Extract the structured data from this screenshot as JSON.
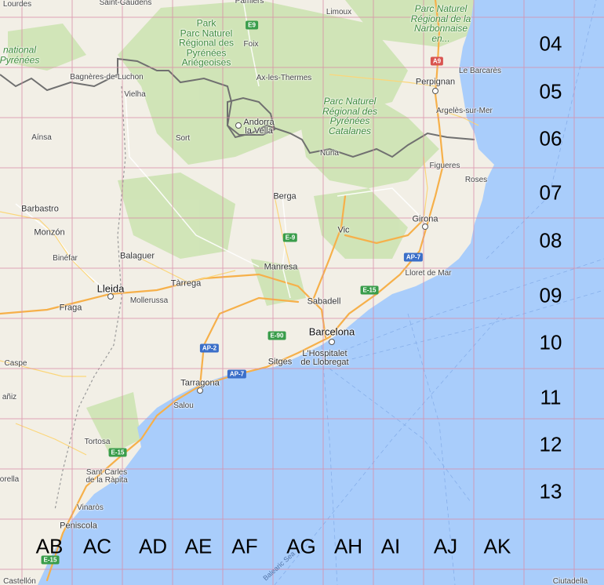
{
  "map": {
    "country_cities": [
      {
        "name": "Lourdes"
      },
      {
        "name": "Saint-Gaudens"
      },
      {
        "name": "Pamiers"
      },
      {
        "name": "Limoux"
      },
      {
        "name": "Bagnères-de-Luchon"
      },
      {
        "name": "Foix"
      },
      {
        "name": "Vielha"
      },
      {
        "name": "Ax-les-Thermes"
      },
      {
        "name": "Perpignan"
      },
      {
        "name": "Le Barcarès"
      },
      {
        "name": "Argelès-sur-Mer"
      },
      {
        "name": "Andorra\nla Vella"
      },
      {
        "name": "Aínsa"
      },
      {
        "name": "Sort"
      },
      {
        "name": "Núria"
      },
      {
        "name": "Figueres"
      },
      {
        "name": "Roses"
      },
      {
        "name": "Barbastro"
      },
      {
        "name": "Berga"
      },
      {
        "name": "Monzón"
      },
      {
        "name": "Vic"
      },
      {
        "name": "Girona"
      },
      {
        "name": "Binéfar"
      },
      {
        "name": "Balaguer"
      },
      {
        "name": "Manresa"
      },
      {
        "name": "Lloret de Mar"
      },
      {
        "name": "Lleida"
      },
      {
        "name": "Tàrrega"
      },
      {
        "name": "Mollerussa"
      },
      {
        "name": "Sabadell"
      },
      {
        "name": "Fraga"
      },
      {
        "name": "Barcelona"
      },
      {
        "name": "L'Hospitalet\nde Llobregat"
      },
      {
        "name": "Sitges"
      },
      {
        "name": "Caspe"
      },
      {
        "name": "Tarragona"
      },
      {
        "name": "Salou"
      },
      {
        "name": "Tortosa"
      },
      {
        "name": "Sant Carles\nde la Ràpita"
      },
      {
        "name": "Vinaròs"
      },
      {
        "name": "Peniscola"
      },
      {
        "name": "Castellón"
      },
      {
        "name": "Ciutadella"
      },
      {
        "name": "añiz"
      },
      {
        "name": "orella"
      }
    ],
    "parks": [
      {
        "name": "Park\nParc Naturel\nRégional des\nPyrénées\nAriégeoises"
      },
      {
        "name": "Parc Naturel\nRégional de la\nNarbonnaise\nen..."
      },
      {
        "name": "Parc Naturel\nRégional des\nPyrénées\nCatalanes"
      },
      {
        "name": "national\nPyrénées"
      }
    ],
    "road_shields": [
      "E9",
      "A9",
      "E-9",
      "AP-7",
      "E-15",
      "E-90",
      "AP-2",
      "AP-7",
      "E-15",
      "E-15"
    ],
    "sea_label": "Balearic Sea",
    "grid_rows": [
      "04",
      "05",
      "06",
      "07",
      "08",
      "09",
      "10",
      "11",
      "12",
      "13"
    ],
    "grid_cols": [
      "AB",
      "AC",
      "AD",
      "AE",
      "AF",
      "AG",
      "AH",
      "AI",
      "AJ",
      "AK"
    ],
    "colors": {
      "sea": "#a9cdfb",
      "land": "#f2efe6",
      "forest": "#cde3b3",
      "grid": "#d98aa6",
      "border": "#707070",
      "motorway": "#f6b04a"
    }
  }
}
